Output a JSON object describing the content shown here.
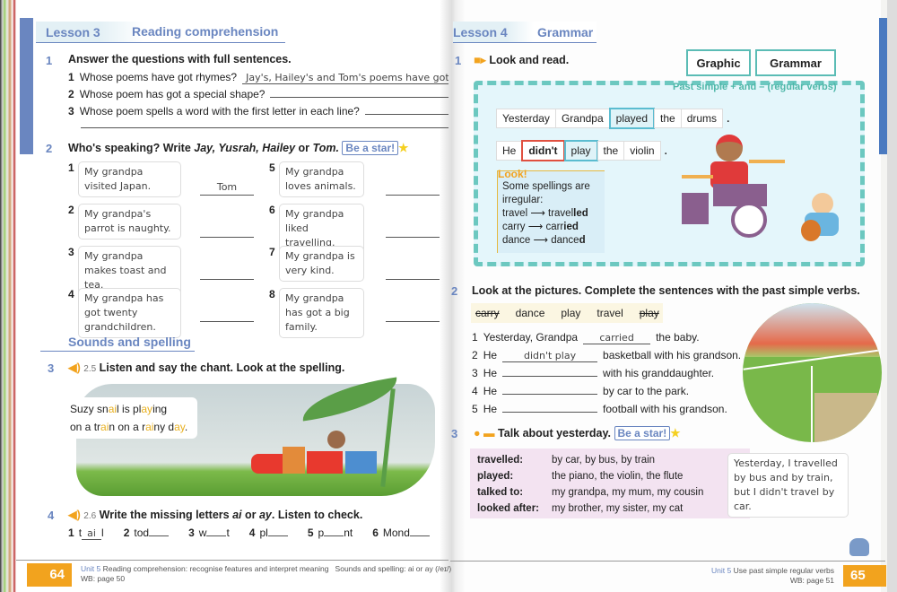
{
  "left": {
    "lesson": "Lesson 3",
    "lesson_title": "Reading comprehension",
    "ex1": {
      "num": "1",
      "title": "Answer the questions with full sentences.",
      "items": [
        {
          "n": "1",
          "q": "Whose poems have got rhymes?",
          "a": "Jay's, Hailey's and Tom's poems have got rhy"
        },
        {
          "n": "2",
          "q": "Whose poem has got a special shape?",
          "a": ""
        },
        {
          "n": "3",
          "q": "Whose poem spells a word with the first letter in each line?",
          "a": ""
        }
      ]
    },
    "ex2": {
      "num": "2",
      "title_a": "Who's speaking? Write ",
      "names": "Jay, Yusrah, Hailey",
      "or": " or ",
      "last": "Tom.",
      "star": "Be a star!",
      "items": [
        {
          "n": "1",
          "text": "My grandpa visited Japan.",
          "a": "Tom"
        },
        {
          "n": "2",
          "text": "My grandpa's parrot is naughty.",
          "a": ""
        },
        {
          "n": "3",
          "text": "My grandpa makes toast and tea.",
          "a": ""
        },
        {
          "n": "4",
          "text": "My grandpa has got twenty grandchildren.",
          "a": ""
        },
        {
          "n": "5",
          "text": "My grandpa loves animals.",
          "a": ""
        },
        {
          "n": "6",
          "text": "My grandpa liked travelling.",
          "a": ""
        },
        {
          "n": "7",
          "text": "My grandpa is very kind.",
          "a": ""
        },
        {
          "n": "8",
          "text": "My grandpa has got a big family.",
          "a": ""
        }
      ]
    },
    "sounds": "Sounds and spelling",
    "ex3": {
      "num": "3",
      "track": "2.5",
      "title": "Listen and say the chant. Look at the spelling.",
      "chant": [
        [
          {
            "t": "Suzy sn"
          },
          {
            "t": "ai",
            "h": 1
          },
          {
            "t": "l is pl"
          },
          {
            "t": "ay",
            "h": 1
          },
          {
            "t": "ing"
          }
        ],
        [
          {
            "t": "on a tr"
          },
          {
            "t": "ai",
            "h": 1
          },
          {
            "t": "n on a r"
          },
          {
            "t": "ai",
            "h": 1
          },
          {
            "t": "ny d"
          },
          {
            "t": "ay",
            "h": 1
          },
          {
            "t": "."
          }
        ]
      ]
    },
    "ex4": {
      "num": "4",
      "track": "2.6",
      "title_a": "Write the missing letters ",
      "ai": "ai",
      "or": " or ",
      "ay": "ay",
      "title_b": ". Listen to check.",
      "items": [
        {
          "n": "1",
          "pre": "t",
          "fill": "ai",
          "post": "l"
        },
        {
          "n": "2",
          "pre": "tod",
          "fill": "",
          "post": ""
        },
        {
          "n": "3",
          "pre": "w",
          "fill": "",
          "post": "t"
        },
        {
          "n": "4",
          "pre": "pl",
          "fill": "",
          "post": ""
        },
        {
          "n": "5",
          "pre": "p",
          "fill": "",
          "post": "nt"
        },
        {
          "n": "6",
          "pre": "Mond",
          "fill": "",
          "post": ""
        }
      ]
    },
    "footer": {
      "page": "64",
      "unit": "Unit 5",
      "desc": "Reading comprehension: recognise features and interpret meaning",
      "sounds": "Sounds and spelling: ai or ay (/eɪ/)",
      "wb": "WB: page 50"
    }
  },
  "right": {
    "lesson": "Lesson 4",
    "lesson_title": "Grammar",
    "ex1": {
      "num": "1",
      "title": "Look and read.",
      "tab1": "Graphic",
      "tab2": "Grammar",
      "sub": "Past simple + and – (regular verbs)",
      "s1": [
        "Yesterday",
        "Grandpa",
        "played",
        "the",
        "drums"
      ],
      "s2": [
        "He",
        "didn't",
        "play",
        "the",
        "violin"
      ],
      "look": "Look!",
      "look_lines": [
        "Some spellings are",
        "irregular:"
      ],
      "pairs": [
        {
          "a": "travel",
          "b": "travel",
          "c": "led"
        },
        {
          "a": "carry",
          "b": "carr",
          "c": "ied"
        },
        {
          "a": "dance",
          "b": "dance",
          "c": "d"
        }
      ]
    },
    "ex2": {
      "num": "2",
      "title": "Look at the pictures. Complete the sentences with the past simple verbs.",
      "words": [
        {
          "w": "carry",
          "used": true
        },
        {
          "w": "dance",
          "used": false
        },
        {
          "w": "play",
          "used": false
        },
        {
          "w": "travel",
          "used": false
        },
        {
          "w": "play",
          "used": true
        }
      ],
      "items": [
        {
          "n": "1",
          "pre": "Yesterday, Grandpa",
          "a": "carried",
          "post": "the baby."
        },
        {
          "n": "2",
          "pre": "He",
          "a": "didn't play",
          "post": "basketball with his grandson."
        },
        {
          "n": "3",
          "pre": "He",
          "a": "",
          "post": "with his granddaughter."
        },
        {
          "n": "4",
          "pre": "He",
          "a": "",
          "post": "by car to the park."
        },
        {
          "n": "5",
          "pre": "He",
          "a": "",
          "post": "football with his grandson."
        }
      ]
    },
    "ex3": {
      "num": "3",
      "title": "Talk about yesterday.",
      "star": "Be a star!",
      "rows": [
        {
          "k": "travelled:",
          "v": "by car, by bus, by train"
        },
        {
          "k": "played:",
          "v": "the piano, the violin, the flute"
        },
        {
          "k": "talked to:",
          "v": "my grandpa, my mum, my cousin"
        },
        {
          "k": "looked after:",
          "v": "my brother, my sister, my cat"
        }
      ],
      "bubble": "Yesterday, I travelled by bus and by train, but I didn't travel by car."
    },
    "footer": {
      "page": "65",
      "unit": "Unit 5",
      "desc": "Use past simple regular verbs",
      "wb": "WB: page 51"
    }
  },
  "colors": {
    "accent_blue": "#6a86c0",
    "orange": "#f2a31e",
    "teal": "#5bbcd0",
    "pink": "#f3e3f1",
    "red": "#e05040"
  }
}
